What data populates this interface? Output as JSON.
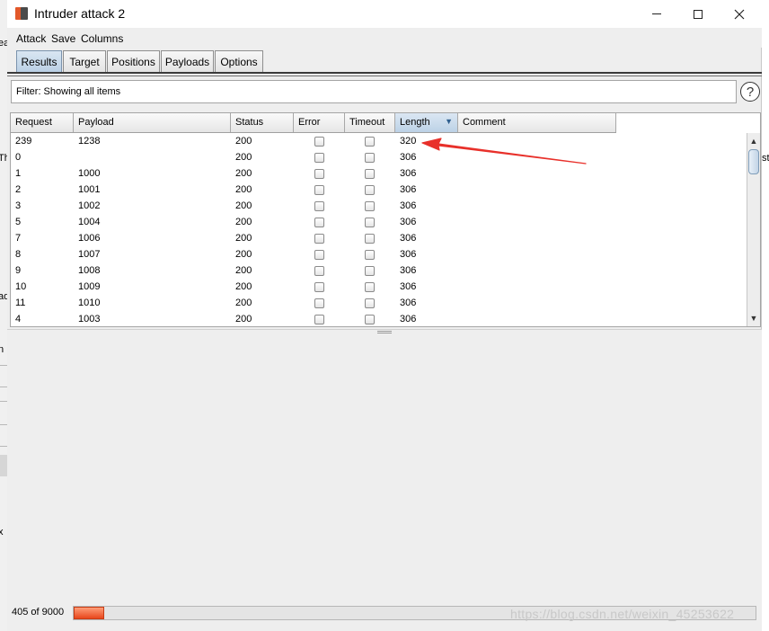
{
  "window": {
    "title": "Intruder attack 2"
  },
  "menu": {
    "items": [
      "Attack",
      "Save",
      "Columns"
    ]
  },
  "tabs": [
    {
      "label": "Results",
      "active": true
    },
    {
      "label": "Target",
      "active": false
    },
    {
      "label": "Positions",
      "active": false
    },
    {
      "label": "Payloads",
      "active": false
    },
    {
      "label": "Options",
      "active": false
    }
  ],
  "filter": {
    "text": "Filter: Showing all items"
  },
  "help": {
    "glyph": "?"
  },
  "table": {
    "columns": [
      "Request",
      "Payload",
      "Status",
      "Error",
      "Timeout",
      "Length",
      "Comment"
    ],
    "sorted_column": "Length",
    "rows": [
      {
        "request": "239",
        "payload": "1238",
        "status": "200",
        "length": "320"
      },
      {
        "request": "0",
        "payload": "",
        "status": "200",
        "length": "306"
      },
      {
        "request": "1",
        "payload": "1000",
        "status": "200",
        "length": "306"
      },
      {
        "request": "2",
        "payload": "1001",
        "status": "200",
        "length": "306"
      },
      {
        "request": "3",
        "payload": "1002",
        "status": "200",
        "length": "306"
      },
      {
        "request": "5",
        "payload": "1004",
        "status": "200",
        "length": "306"
      },
      {
        "request": "7",
        "payload": "1006",
        "status": "200",
        "length": "306"
      },
      {
        "request": "8",
        "payload": "1007",
        "status": "200",
        "length": "306"
      },
      {
        "request": "9",
        "payload": "1008",
        "status": "200",
        "length": "306"
      },
      {
        "request": "10",
        "payload": "1009",
        "status": "200",
        "length": "306"
      },
      {
        "request": "11",
        "payload": "1010",
        "status": "200",
        "length": "306"
      },
      {
        "request": "4",
        "payload": "1003",
        "status": "200",
        "length": "306"
      }
    ]
  },
  "status": {
    "progress_text": "405 of 9000",
    "progress_fraction": 0.045
  },
  "watermark": "https://blog.csdn.net/weixin_45253622",
  "annotation_color": "#e8302a",
  "background_window_fragments": [
    "ea",
    "Th",
    "st",
    "ad",
    "n",
    "x"
  ]
}
